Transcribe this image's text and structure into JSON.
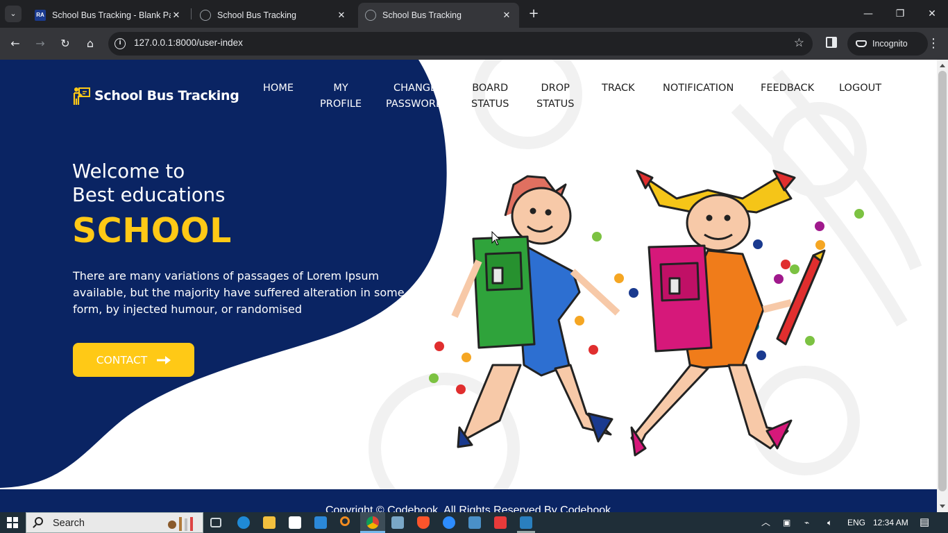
{
  "browser": {
    "tabs": [
      {
        "title": "School Bus Tracking - Blank Pa",
        "favicon": "ra-favicon",
        "favicon_text": "RA",
        "active": false
      },
      {
        "title": "School Bus Tracking",
        "favicon": "globe-icon",
        "active": false
      },
      {
        "title": "School Bus Tracking",
        "favicon": "globe-icon",
        "active": true
      }
    ],
    "url": "127.0.0.1:8000/user-index",
    "profile_label": "Incognito"
  },
  "site": {
    "brand": "School Bus Tracking",
    "nav": {
      "home": "HOME",
      "my_profile_1": "MY",
      "my_profile_2": "PROFILE",
      "change_password_1": "CHANGE",
      "change_password_2": "PASSWORD",
      "board_status_1": "BOARD",
      "board_status_2": "STATUS",
      "drop_status_1": "DROP",
      "drop_status_2": "STATUS",
      "track": "TRACK",
      "notification": "NOTIFICATION",
      "feedback": "FEEDBACK",
      "logout": "LOGOUT"
    },
    "hero": {
      "line1": "Welcome to",
      "line2": "Best educations",
      "title": "SCHOOL",
      "text": "There are many variations of passages of Lorem Ipsum available, but the majority have suffered alteration in some form, by injected humour, or randomised",
      "button": "CONTACT"
    },
    "footer": "Copyright © Codebook. All Rights Reserved By Codebook"
  },
  "taskbar": {
    "search_label": "Search",
    "language": "ENG",
    "time": "12:34 AM"
  },
  "colors": {
    "navy": "#0a2463",
    "accent_yellow": "#ffc916",
    "nav_text_light": "#1f1f1f"
  }
}
